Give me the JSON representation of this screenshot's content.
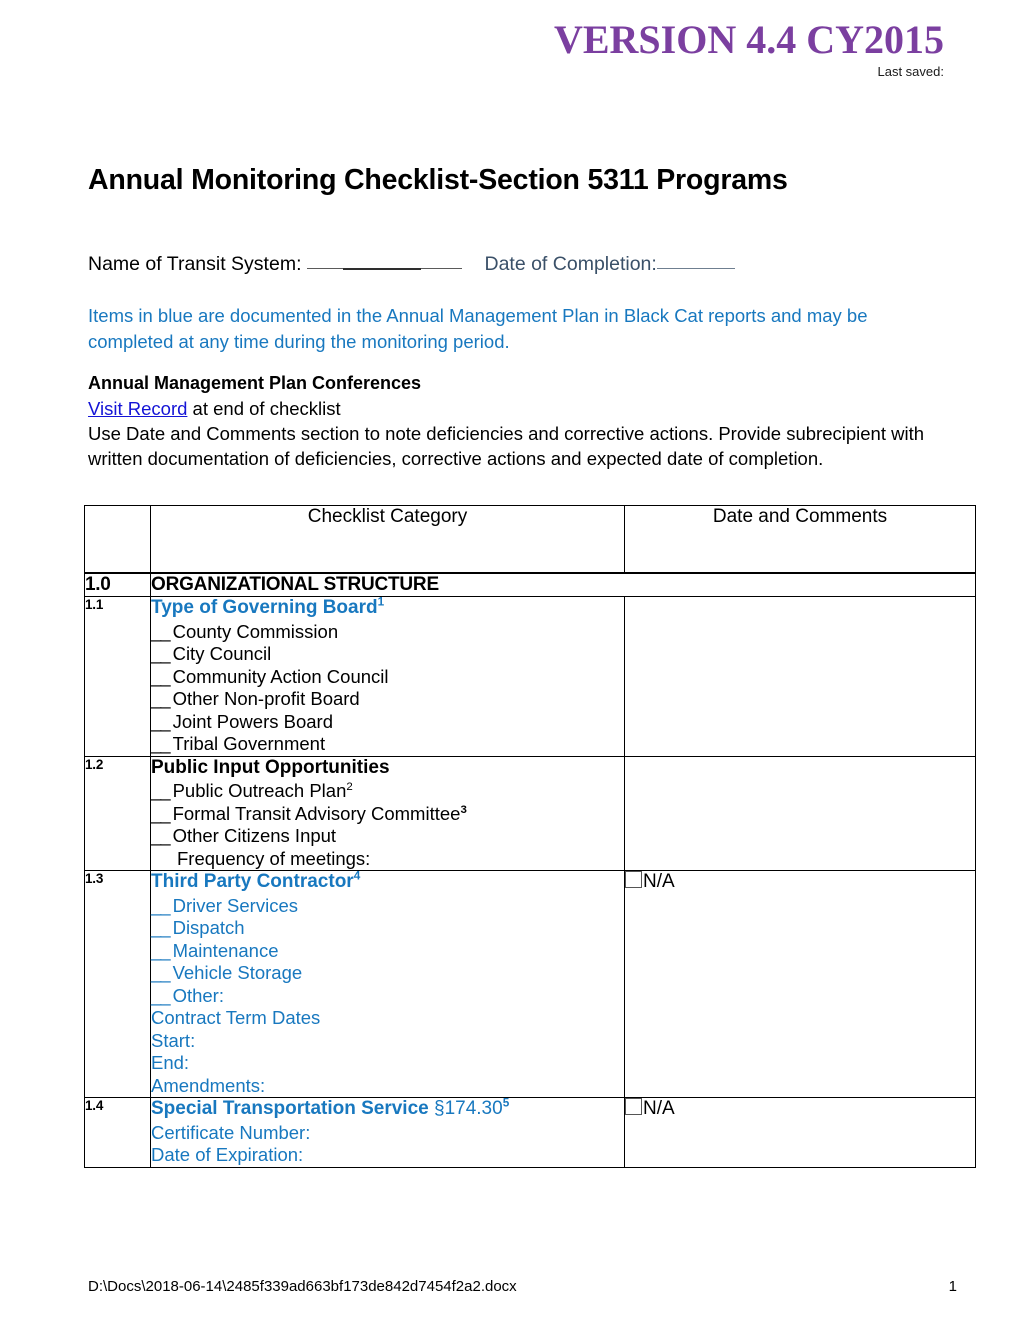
{
  "header": {
    "version_title": "VERSION 4.4 CY2015",
    "last_saved_label": "Last saved:"
  },
  "document": {
    "title": "Annual Monitoring Checklist-Section 5311 Programs",
    "name_of_system_label": "Name of Transit System:",
    "date_of_completion_label": "Date of Completion:",
    "intro_blue": "Items in blue are documented in the Annual Management Plan in Black Cat reports and may be completed at any time during the monitoring period.",
    "conferences_heading": "Annual Management Plan Conferences",
    "visit_record_link": "Visit Record",
    "visit_record_suffix": " at end of checklist",
    "instructions": "Use Date and Comments section to note deficiencies and corrective actions.  Provide subrecipient with written documentation of deficiencies, corrective actions and expected date of completion."
  },
  "table": {
    "headers": {
      "number_col": "",
      "category_col": "Checklist Category",
      "date_col": "Date and Comments"
    },
    "section": {
      "number": "1.0",
      "title": "ORGANIZATIONAL STRUCTURE"
    },
    "rows": [
      {
        "number": "1.1",
        "heading": "Type of Governing Board",
        "heading_sup": "1",
        "heading_color": "blue",
        "body_color": "black",
        "options": [
          "County Commission",
          "City Council",
          "Community Action Council",
          "Other Non-profit Board",
          "Joint Powers Board",
          "Tribal Government"
        ],
        "extra_lines": [],
        "na_checkbox": false,
        "na_label": ""
      },
      {
        "number": "1.2",
        "heading": "Public Input Opportunities",
        "heading_sup": "",
        "heading_color": "black",
        "body_color": "black",
        "options": [
          "Public Outreach Plan",
          "Formal Transit Advisory Committee",
          "Other Citizens Input"
        ],
        "option_sups": [
          "2",
          "3",
          ""
        ],
        "indented_lines": [
          "Frequency of meetings:"
        ],
        "extra_lines": [],
        "na_checkbox": false,
        "na_label": ""
      },
      {
        "number": "1.3",
        "heading": "Third Party Contractor",
        "heading_sup": "4",
        "heading_color": "blue",
        "body_color": "blue",
        "options": [
          "Driver Services",
          "Dispatch",
          "Maintenance",
          "Vehicle Storage",
          "Other:"
        ],
        "extra_lines": [
          "Contract Term Dates",
          "Start:",
          "End:",
          "Amendments:"
        ],
        "na_checkbox": true,
        "na_label": "N/A"
      },
      {
        "number": "1.4",
        "heading": "Special Transportation Service",
        "heading_suffix": "§174.30",
        "heading_sup": "5",
        "heading_color": "blue",
        "body_color": "blue",
        "options": [],
        "extra_lines": [
          "Certificate Number:",
          "Date of Expiration:"
        ],
        "na_checkbox": true,
        "na_label": "N/A"
      }
    ]
  },
  "footer": {
    "path": "D:\\Docs\\2018-06-14\\2485f339ad663bf173de842d7454f2a2.docx",
    "page_number": "1"
  },
  "colors": {
    "version_purple": "#7B3FA0",
    "body_blue": "#1878bf",
    "link_blue": "#1414d6",
    "date_label": "#3a5068"
  }
}
